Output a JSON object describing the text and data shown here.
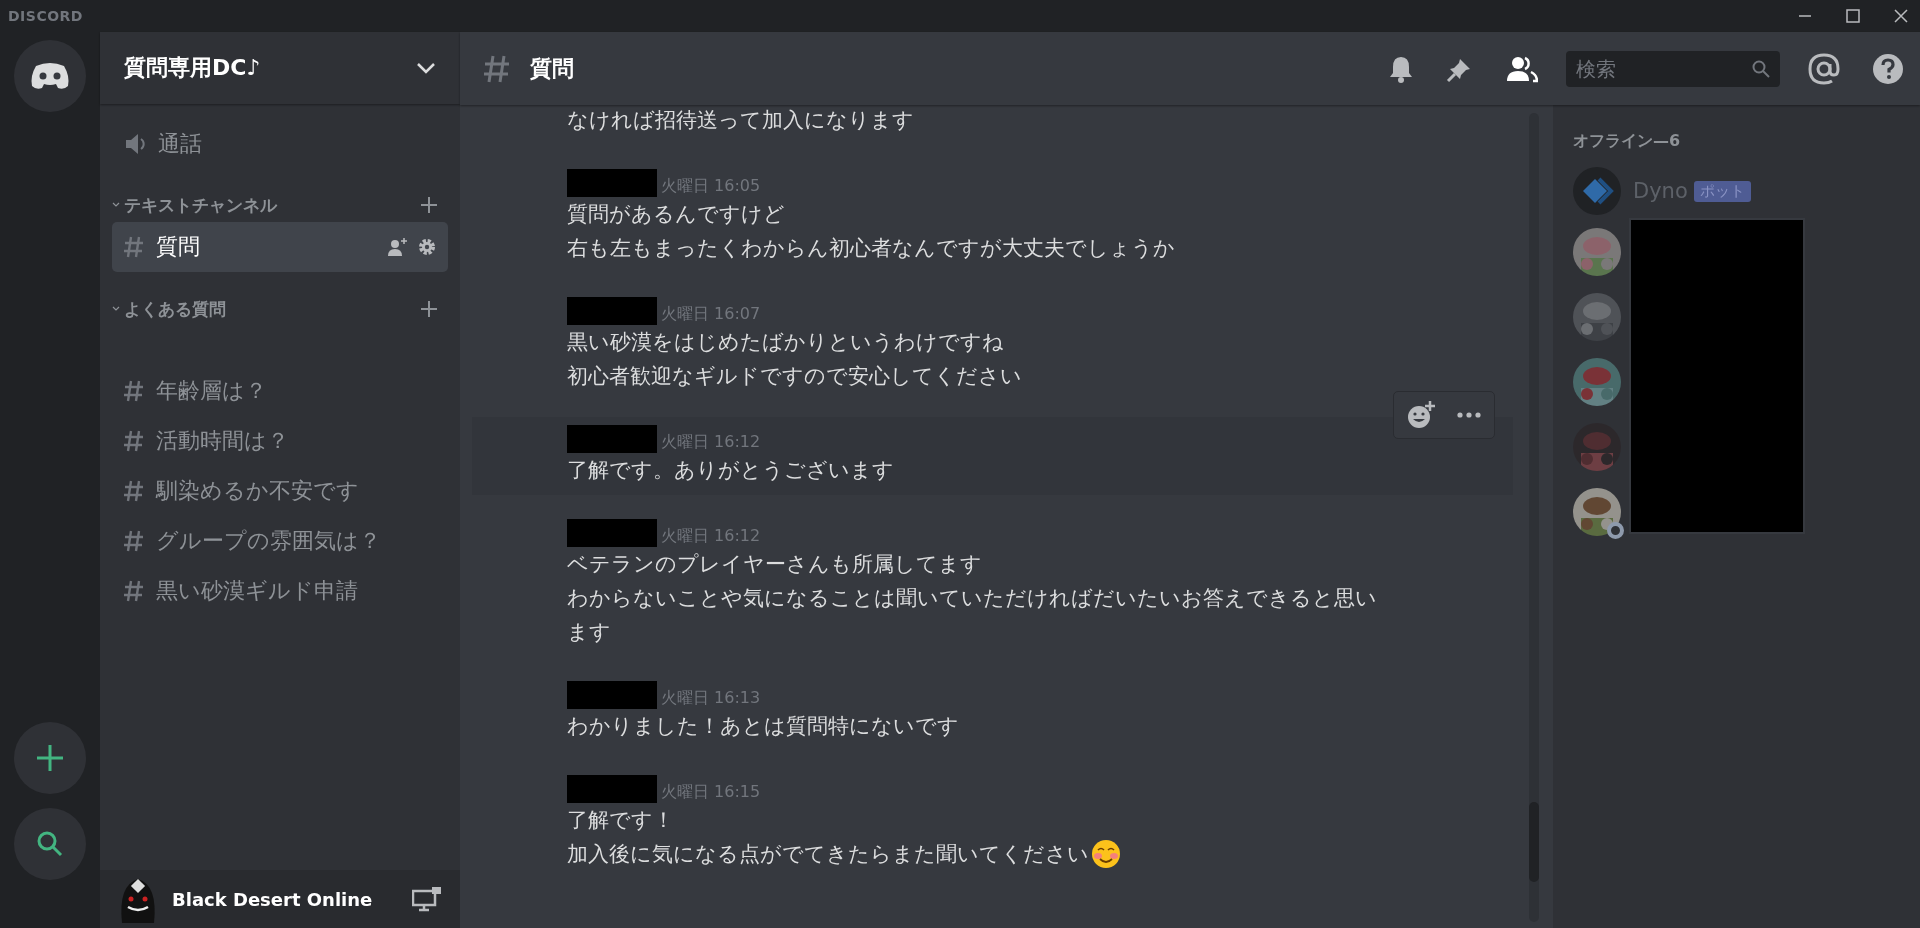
{
  "titlebar": {
    "logo": "DISCORD"
  },
  "server": {
    "name": "質問専用DC♪"
  },
  "sidebar": {
    "voice_channels": [
      {
        "name": "通話"
      }
    ],
    "categories": [
      {
        "name": "テキストチャンネル",
        "channels": [
          {
            "name": "質問",
            "selected": true
          }
        ]
      },
      {
        "name": "よくある質問",
        "channels": [
          {
            "name": "年齢層は？",
            "selected": false
          },
          {
            "name": "活動時間は？",
            "selected": false
          },
          {
            "name": "馴染めるか不安です",
            "selected": false
          },
          {
            "name": "グループの雰囲気は？",
            "selected": false
          },
          {
            "name": "黒い砂漠ギルド申請",
            "selected": false
          }
        ]
      }
    ]
  },
  "user_panel": {
    "name": "Black Desert Online"
  },
  "channel_header": {
    "name": "質問"
  },
  "search": {
    "placeholder": "検索"
  },
  "messages": [
    {
      "kind": "continuation",
      "lines": [
        "なければ招待送って加入になります"
      ]
    },
    {
      "kind": "message",
      "time": "火曜日 16:05",
      "hovered": false,
      "lines": [
        "質問があるんですけど",
        "右も左もまったくわからん初心者なんですが大丈夫でしょうか"
      ]
    },
    {
      "kind": "message",
      "time": "火曜日 16:07",
      "hovered": false,
      "lines": [
        "黒い砂漠をはじめたばかりというわけですね",
        "初心者歓迎なギルドですので安心してください"
      ]
    },
    {
      "kind": "message",
      "time": "火曜日 16:12",
      "hovered": true,
      "lines": [
        "了解です。ありがとうございます"
      ]
    },
    {
      "kind": "message",
      "time": "火曜日 16:12",
      "hovered": false,
      "lines": [
        "ベテランのプレイヤーさんも所属してます",
        "わからないことや気になることは聞いていただければだいたいお答えできると思い",
        "ます"
      ]
    },
    {
      "kind": "message",
      "time": "火曜日 16:13",
      "hovered": false,
      "lines": [
        "わかりました！あとは質問特にないです"
      ]
    },
    {
      "kind": "message",
      "time": "火曜日 16:15",
      "hovered": false,
      "emoji": true,
      "lines": [
        "了解です！",
        "加入後に気になる点がでてきたらまた聞いてください"
      ]
    }
  ],
  "members": {
    "heading": "オフライン—6",
    "rows": [
      {
        "kind": "bot",
        "name": "Dyno",
        "tag": "ポット"
      },
      {
        "kind": "redacted",
        "status_ring": false
      },
      {
        "kind": "redacted",
        "status_ring": false
      },
      {
        "kind": "redacted",
        "status_ring": false
      },
      {
        "kind": "redacted",
        "status_ring": false
      },
      {
        "kind": "redacted",
        "status_ring": true
      }
    ]
  }
}
